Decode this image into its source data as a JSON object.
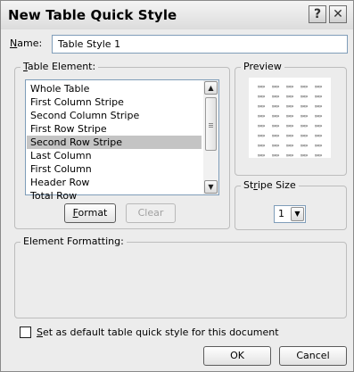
{
  "window": {
    "title": "New Table Quick Style",
    "help_glyph": "?",
    "close_glyph": "✕"
  },
  "name": {
    "label_accel": "N",
    "label_rest": "ame:",
    "value": "Table Style 1"
  },
  "table_element": {
    "label_accel": "T",
    "label_rest": "able Element:",
    "items": [
      "Whole Table",
      "First Column Stripe",
      "Second Column Stripe",
      "First Row Stripe",
      "Second Row Stripe",
      "Last Column",
      "First Column",
      "Header Row",
      "Total Row"
    ],
    "selected": "Second Row Stripe",
    "format_button": {
      "accel": "F",
      "rest": "ormat"
    },
    "clear_button": {
      "label": "Clear"
    }
  },
  "preview": {
    "label": "Preview",
    "cell_glyph": "»»»"
  },
  "stripe_size": {
    "label_pre": "St",
    "label_accel": "r",
    "label_post": "ipe Size",
    "value": "1"
  },
  "element_formatting": {
    "label": "Element Formatting:"
  },
  "default_checkbox": {
    "label_accel": "S",
    "label_rest": "et as default table quick style for this document",
    "checked": false
  },
  "buttons": {
    "ok": "OK",
    "cancel": "Cancel"
  },
  "colors": {
    "selection_bg": "#c4c4c4",
    "dialog_bg": "#ececec",
    "field_border": "#7f9db9"
  }
}
